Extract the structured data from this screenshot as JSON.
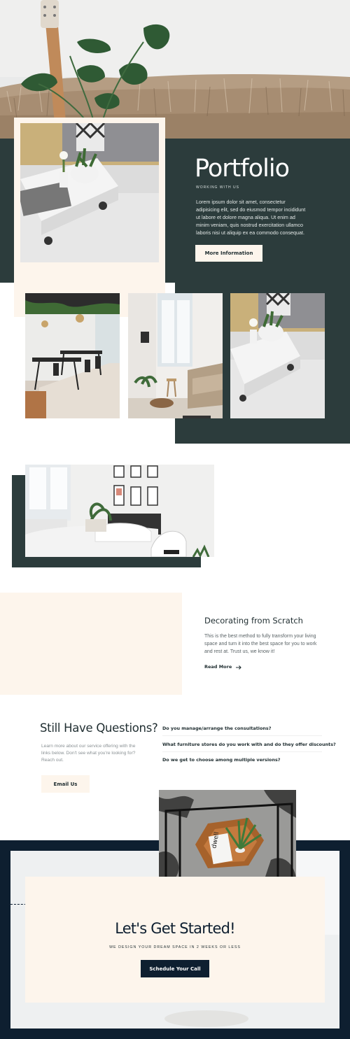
{
  "colors": {
    "dark_teal": "#2c3c3c",
    "navy": "#0e1f30",
    "cream": "#fdf5ec",
    "text_body": "#5a6366"
  },
  "hero": {
    "title": "Portfolio",
    "subtitle": "WORKING WITH US",
    "body": "Lorem ipsum dolor sit amet, consectetur adipisicing elit, sed do eiusmod tempor incididunt ut labore et dolore magna aliqua. Ut enim ad minim veniam, quis nostrud exercitation ullamco laboris nisi ut aliquip ex ea commodo consequat.",
    "button_label": "More Information"
  },
  "feature": {
    "heading": "Decorating from Scratch",
    "body": "This is the best method to fully transform your living space and turn it into the best space for you to work and rest at. Trust us, we know it!",
    "link_label": "Read More",
    "link_icon": "arrow-right-icon"
  },
  "faq": {
    "heading": "Still Have Questions?",
    "body": "Learn more about our service offering with the links below. Don't see what you're looking for? Reach out.",
    "button_label": "Email Us",
    "questions": [
      "Do you manage/arrange the consultations?",
      "What furniture stores do you work with and do they offer discounts?",
      "Do we get to choose among multiple versions?"
    ]
  },
  "cta": {
    "heading": "Let's Get Started!",
    "subtitle": "WE DESIGN YOUR DREAM SPACE IN 2 WEEKS OR LESS",
    "button_label": "Schedule Your Call"
  }
}
